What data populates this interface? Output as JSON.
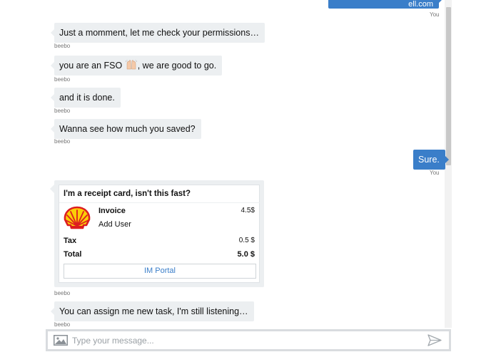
{
  "conversation": {
    "top_user_message": "ell.com",
    "top_user_sender": "You",
    "messages": [
      {
        "text": "Just a momment, let me check your permissions…",
        "sender": "beebo"
      },
      {
        "text_before": "you are an FSO",
        "emoji": "raised-hands-emoji",
        "text_after": ", we are good to go.",
        "sender": "beebo"
      },
      {
        "text": "and it is done.",
        "sender": "beebo"
      },
      {
        "text": "Wanna see how much you saved?",
        "sender": "beebo"
      },
      {
        "text": "Sure.",
        "sender": "You"
      },
      {
        "text": "You can assign me new task, I'm still listening…",
        "sender": "beebo"
      }
    ]
  },
  "receipt": {
    "title": "I'm a receipt card, isn't this fast?",
    "item_title": "Invoice",
    "item_subtitle": "Add User",
    "item_price": "4.5$",
    "tax_label": "Tax",
    "tax_value": "0.5 $",
    "total_label": "Total",
    "total_value": "5.0 $",
    "button_label": "IM Portal",
    "sender": "beebo",
    "logo": "shell-logo"
  },
  "composer": {
    "placeholder": "Type your message...",
    "image_icon": "image-icon",
    "send_icon": "send-icon"
  },
  "colors": {
    "user_bubble": "#3a7ec9",
    "bot_bubble": "#eceff1",
    "logo_red": "#dd1d21",
    "logo_yellow": "#fbce07"
  }
}
